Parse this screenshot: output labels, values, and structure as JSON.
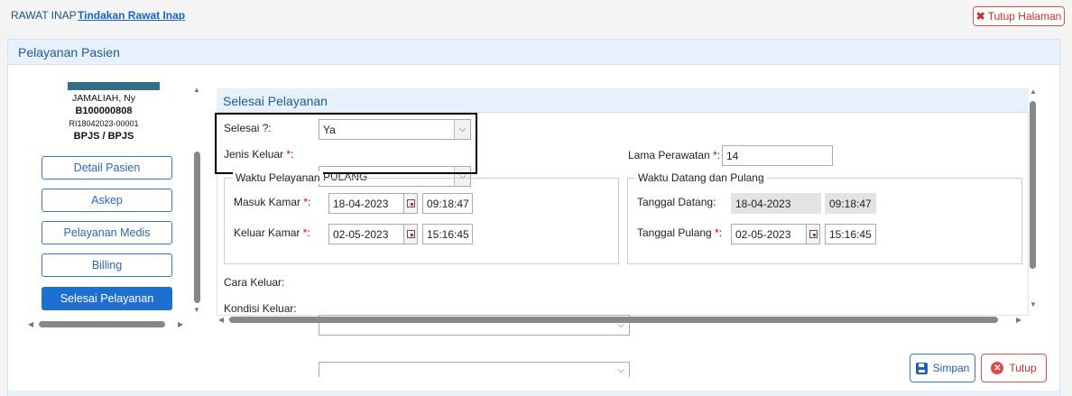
{
  "breadcrumb": {
    "module": "RAWAT INAP",
    "page": "Tindakan Rawat Inap"
  },
  "top_actions": {
    "close_page": "Tutup Halaman"
  },
  "panel": {
    "title": "Pelayanan Pasien"
  },
  "patient": {
    "name": "JAMALIAH, Ny",
    "mrn": "B100000808",
    "registration": "RI18042023-00001",
    "payer": "BPJS / BPJS"
  },
  "nav": [
    {
      "label": "Detail Pasien",
      "active": false
    },
    {
      "label": "Askep",
      "active": false
    },
    {
      "label": "Pelayanan Medis",
      "active": false
    },
    {
      "label": "Billing",
      "active": false
    },
    {
      "label": "Selesai Pelayanan",
      "active": true
    }
  ],
  "form": {
    "title": "Selesai Pelayanan",
    "selesai": {
      "label": "Selesai ?:",
      "value": "Ya"
    },
    "jenis_keluar": {
      "label": "Jenis Keluar",
      "req": "*",
      "colon": ":",
      "value": "PULANG"
    },
    "lama_perawatan": {
      "label": "Lama Perawatan",
      "req": "*",
      "colon": ":",
      "value": "14"
    },
    "waktu_pelayanan": {
      "legend": "Waktu Pelayanan",
      "masuk": {
        "label": "Masuk Kamar",
        "req": "*",
        "colon": ":",
        "date": "18-04-2023",
        "time": "09:18:47"
      },
      "keluar": {
        "label": "Keluar Kamar",
        "req": "*",
        "colon": ":",
        "date": "02-05-2023",
        "time": "15:16:45"
      }
    },
    "waktu_datang": {
      "legend": "Waktu Datang dan Pulang",
      "datang": {
        "label": "Tanggal Datang:",
        "date": "18-04-2023",
        "time": "09:18:47"
      },
      "pulang": {
        "label": "Tanggal Pulang",
        "req": "*",
        "colon": ":",
        "date": "02-05-2023",
        "time": "15:16:45"
      }
    },
    "cara_keluar": {
      "label": "Cara Keluar:",
      "value": ""
    },
    "kondisi_keluar": {
      "label": "Kondisi Keluar:",
      "value": ""
    }
  },
  "footer": {
    "save": "Simpan",
    "close": "Tutup"
  },
  "colors": {
    "primary": "#1e6fd0",
    "danger": "#d9534f",
    "header_bg": "#e7f0fb"
  }
}
